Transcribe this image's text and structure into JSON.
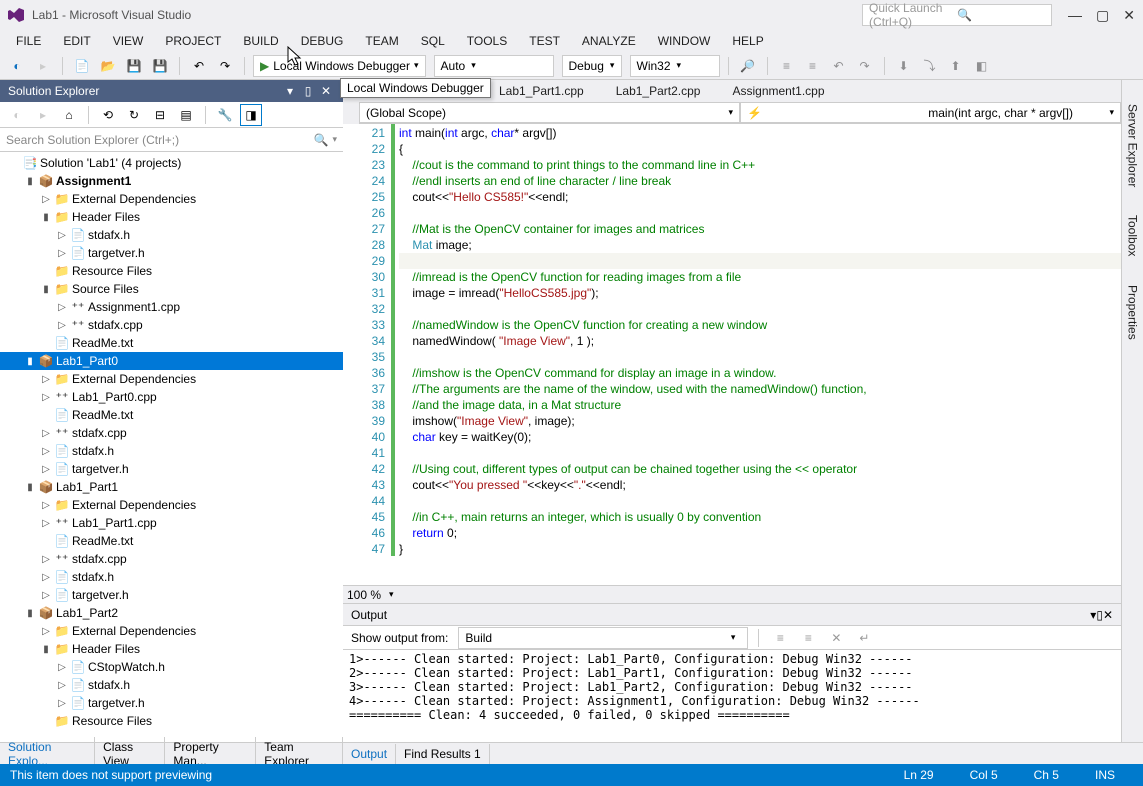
{
  "window": {
    "title": "Lab1 - Microsoft Visual Studio"
  },
  "quickLaunch": {
    "placeholder": "Quick Launch (Ctrl+Q)"
  },
  "menu": [
    "FILE",
    "EDIT",
    "VIEW",
    "PROJECT",
    "BUILD",
    "DEBUG",
    "TEAM",
    "SQL",
    "TOOLS",
    "TEST",
    "ANALYZE",
    "WINDOW",
    "HELP"
  ],
  "toolbar": {
    "debuggerLabel": "Local Windows Debugger",
    "tooltip": "Local Windows Debugger",
    "platformCombo": "Auto",
    "configCombo": "Debug",
    "archCombo": "Win32"
  },
  "solutionExplorer": {
    "title": "Solution Explorer",
    "searchPlaceholder": "Search Solution Explorer (Ctrl+;)",
    "tree": [
      {
        "d": 1,
        "exp": "",
        "t": "Solution 'Lab1' (4 projects)",
        "i": "📑"
      },
      {
        "d": 2,
        "exp": "▮",
        "t": "Assignment1",
        "i": "📦",
        "bold": true
      },
      {
        "d": 3,
        "exp": "▷",
        "t": "External Dependencies",
        "i": "📁"
      },
      {
        "d": 3,
        "exp": "▮",
        "t": "Header Files",
        "i": "📁"
      },
      {
        "d": 4,
        "exp": "▷",
        "t": "stdafx.h",
        "i": "📄"
      },
      {
        "d": 4,
        "exp": "▷",
        "t": "targetver.h",
        "i": "📄"
      },
      {
        "d": 3,
        "exp": "",
        "t": "Resource Files",
        "i": "📁"
      },
      {
        "d": 3,
        "exp": "▮",
        "t": "Source Files",
        "i": "📁"
      },
      {
        "d": 4,
        "exp": "▷",
        "t": "Assignment1.cpp",
        "i": "⁺⁺"
      },
      {
        "d": 4,
        "exp": "▷",
        "t": "stdafx.cpp",
        "i": "⁺⁺"
      },
      {
        "d": 3,
        "exp": "",
        "t": "ReadMe.txt",
        "i": "📄"
      },
      {
        "d": 2,
        "exp": "▮",
        "t": "Lab1_Part0",
        "i": "📦",
        "sel": true
      },
      {
        "d": 3,
        "exp": "▷",
        "t": "External Dependencies",
        "i": "📁"
      },
      {
        "d": 3,
        "exp": "▷",
        "t": "Lab1_Part0.cpp",
        "i": "⁺⁺"
      },
      {
        "d": 3,
        "exp": "",
        "t": "ReadMe.txt",
        "i": "📄"
      },
      {
        "d": 3,
        "exp": "▷",
        "t": "stdafx.cpp",
        "i": "⁺⁺"
      },
      {
        "d": 3,
        "exp": "▷",
        "t": "stdafx.h",
        "i": "📄"
      },
      {
        "d": 3,
        "exp": "▷",
        "t": "targetver.h",
        "i": "📄"
      },
      {
        "d": 2,
        "exp": "▮",
        "t": "Lab1_Part1",
        "i": "📦"
      },
      {
        "d": 3,
        "exp": "▷",
        "t": "External Dependencies",
        "i": "📁"
      },
      {
        "d": 3,
        "exp": "▷",
        "t": "Lab1_Part1.cpp",
        "i": "⁺⁺"
      },
      {
        "d": 3,
        "exp": "",
        "t": "ReadMe.txt",
        "i": "📄"
      },
      {
        "d": 3,
        "exp": "▷",
        "t": "stdafx.cpp",
        "i": "⁺⁺"
      },
      {
        "d": 3,
        "exp": "▷",
        "t": "stdafx.h",
        "i": "📄"
      },
      {
        "d": 3,
        "exp": "▷",
        "t": "targetver.h",
        "i": "📄"
      },
      {
        "d": 2,
        "exp": "▮",
        "t": "Lab1_Part2",
        "i": "📦"
      },
      {
        "d": 3,
        "exp": "▷",
        "t": "External Dependencies",
        "i": "📁"
      },
      {
        "d": 3,
        "exp": "▮",
        "t": "Header Files",
        "i": "📁"
      },
      {
        "d": 4,
        "exp": "▷",
        "t": "CStopWatch.h",
        "i": "📄"
      },
      {
        "d": 4,
        "exp": "▷",
        "t": "stdafx.h",
        "i": "📄"
      },
      {
        "d": 4,
        "exp": "▷",
        "t": "targetver.h",
        "i": "📄"
      },
      {
        "d": 3,
        "exp": "",
        "t": "Resource Files",
        "i": "📁"
      }
    ]
  },
  "editorTabs": [
    "Lab1_Part1.cpp",
    "Lab1_Part2.cpp",
    "Assignment1.cpp"
  ],
  "scope": {
    "left": "(Global Scope)",
    "right": "main(int argc, char * argv[])"
  },
  "code": {
    "start": 21,
    "lines": [
      [
        {
          "c": "kw",
          "t": "int"
        },
        {
          "t": " main("
        },
        {
          "c": "kw",
          "t": "int"
        },
        {
          "t": " argc, "
        },
        {
          "c": "kw",
          "t": "char"
        },
        {
          "t": "* argv[])"
        }
      ],
      [
        {
          "t": "{"
        }
      ],
      [
        {
          "t": "    "
        },
        {
          "c": "cm",
          "t": "//cout is the command to print things to the command line in C++"
        }
      ],
      [
        {
          "t": "    "
        },
        {
          "c": "cm",
          "t": "//endl inserts an end of line character / line break"
        }
      ],
      [
        {
          "t": "    cout<<"
        },
        {
          "c": "st",
          "t": "\"Hello CS585!\""
        },
        {
          "t": "<<endl;"
        }
      ],
      [
        {
          "t": ""
        }
      ],
      [
        {
          "t": "    "
        },
        {
          "c": "cm",
          "t": "//Mat is the OpenCV container for images and matrices"
        }
      ],
      [
        {
          "t": "    "
        },
        {
          "c": "ty",
          "t": "Mat"
        },
        {
          "t": " image;"
        }
      ],
      [
        {
          "t": ""
        }
      ],
      [
        {
          "t": "    "
        },
        {
          "c": "cm",
          "t": "//imread is the OpenCV function for reading images from a file"
        }
      ],
      [
        {
          "t": "    image = imread("
        },
        {
          "c": "st",
          "t": "\"HelloCS585.jpg\""
        },
        {
          "t": ");"
        }
      ],
      [
        {
          "t": ""
        }
      ],
      [
        {
          "t": "    "
        },
        {
          "c": "cm",
          "t": "//namedWindow is the OpenCV function for creating a new window"
        }
      ],
      [
        {
          "t": "    namedWindow( "
        },
        {
          "c": "st",
          "t": "\"Image View\""
        },
        {
          "t": ", 1 );"
        }
      ],
      [
        {
          "t": ""
        }
      ],
      [
        {
          "t": "    "
        },
        {
          "c": "cm",
          "t": "//imshow is the OpenCV command for display an image in a window."
        }
      ],
      [
        {
          "t": "    "
        },
        {
          "c": "cm",
          "t": "//The arguments are the name of the window, used with the namedWindow() function,"
        }
      ],
      [
        {
          "t": "    "
        },
        {
          "c": "cm",
          "t": "//and the image data, in a Mat structure"
        }
      ],
      [
        {
          "t": "    imshow("
        },
        {
          "c": "st",
          "t": "\"Image View\""
        },
        {
          "t": ", image);"
        }
      ],
      [
        {
          "t": "    "
        },
        {
          "c": "kw",
          "t": "char"
        },
        {
          "t": " key = waitKey(0);"
        }
      ],
      [
        {
          "t": ""
        }
      ],
      [
        {
          "t": "    "
        },
        {
          "c": "cm",
          "t": "//Using cout, different types of output can be chained together using the << operator"
        }
      ],
      [
        {
          "t": "    cout<<"
        },
        {
          "c": "st",
          "t": "\"You pressed \""
        },
        {
          "t": "<<key<<"
        },
        {
          "c": "st",
          "t": "\".\""
        },
        {
          "t": "<<endl;"
        }
      ],
      [
        {
          "t": ""
        }
      ],
      [
        {
          "t": "    "
        },
        {
          "c": "cm",
          "t": "//in C++, main returns an integer, which is usually 0 by convention"
        }
      ],
      [
        {
          "t": "    "
        },
        {
          "c": "kw",
          "t": "return"
        },
        {
          "t": " 0;"
        }
      ],
      [
        {
          "t": "}"
        }
      ]
    ]
  },
  "zoom": "100 %",
  "output": {
    "title": "Output",
    "showFromLabel": "Show output from:",
    "showFrom": "Build",
    "lines": [
      "1>------ Clean started: Project: Lab1_Part0, Configuration: Debug Win32 ------",
      "2>------ Clean started: Project: Lab1_Part1, Configuration: Debug Win32 ------",
      "3>------ Clean started: Project: Lab1_Part2, Configuration: Debug Win32 ------",
      "4>------ Clean started: Project: Assignment1, Configuration: Debug Win32 ------",
      "========== Clean: 4 succeeded, 0 failed, 0 skipped =========="
    ]
  },
  "bottomTabsLeft": [
    "Solution Explo...",
    "Class View",
    "Property Man...",
    "Team Explorer"
  ],
  "bottomTabsRight": [
    "Output",
    "Find Results 1"
  ],
  "sideRail": [
    "Server Explorer",
    "Toolbox",
    "Properties"
  ],
  "status": {
    "msg": "This item does not support previewing",
    "ln": "Ln 29",
    "col": "Col 5",
    "ch": "Ch 5",
    "ins": "INS"
  }
}
